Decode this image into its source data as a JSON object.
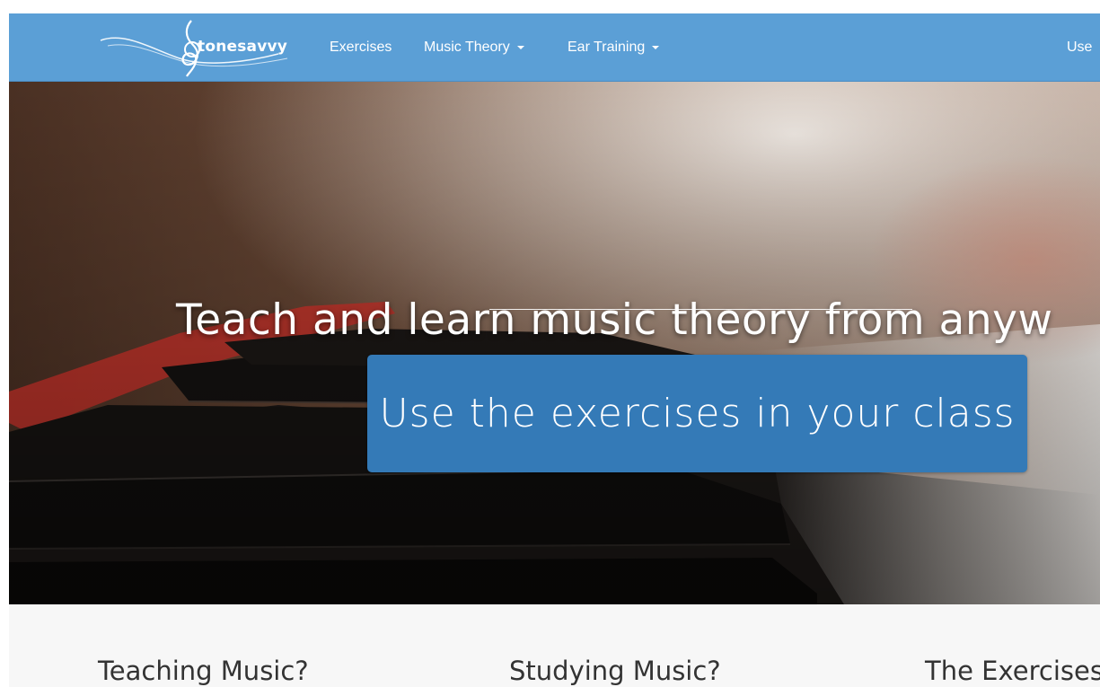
{
  "navbar": {
    "brand": "tonesavvy",
    "links": [
      {
        "label": "Exercises",
        "dropdown": false
      },
      {
        "label": "Music Theory",
        "dropdown": true
      },
      {
        "label": "Ear Training",
        "dropdown": true
      }
    ],
    "right_link": "Use",
    "bg_color": "#5b9fd6"
  },
  "hero": {
    "heading": "Teach and learn music theory from anyw",
    "cta_label": "Use the exercises in your class",
    "cta_color": "#347ab7"
  },
  "features": {
    "titles": [
      "Teaching Music?",
      "Studying Music?",
      "The Exercises"
    ]
  }
}
